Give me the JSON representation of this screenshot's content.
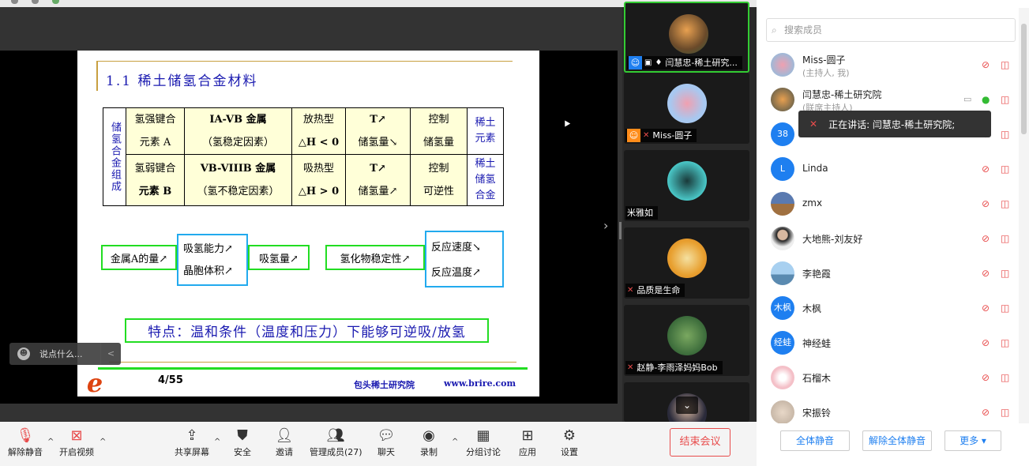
{
  "slide": {
    "title": "1.1  稀土储氢合金材料",
    "table": {
      "row_header": "储氢合金组成",
      "row1": [
        "氢强键合",
        "元素 A",
        "IA-VB 金属",
        "（氢稳定因素）",
        "放热型",
        "△H < 0",
        "T↗",
        "储氢量↘",
        "控制",
        "储氢量"
      ],
      "row2": [
        "氢弱键合",
        "元素 B",
        "VB-VIIIB 金属",
        "（氢不稳定因素）",
        "吸热型",
        "△H > 0",
        "T↗",
        "储氢量↗",
        "控制",
        "可逆性"
      ],
      "side_top": "稀土元素",
      "side_bottom": "稀土储氢合金"
    },
    "flow1": {
      "a": "金属A的量↗",
      "b1": "吸氢能力↗",
      "b2": "晶胞体积↗",
      "c": "吸氢量↗"
    },
    "flow2": {
      "a": "氢化物稳定性↗",
      "b1": "反应速度↘",
      "b2": "反应温度↗"
    },
    "feature": "特点：温和条件（温度和压力）下能够可逆吸/放氢",
    "logo": "e",
    "page": "4/55",
    "org": "包头稀土研究院",
    "url": "www.brire.com"
  },
  "chat": {
    "placeholder": "说点什么...",
    "arrow": "<"
  },
  "collapse_arrow": "›",
  "video_tiles": [
    {
      "name": "闫慧忠-稀土研究...",
      "active": true
    },
    {
      "name": "Miss-圆子",
      "active": false
    },
    {
      "name": "米雅如",
      "active": false
    },
    {
      "name": "品质是生命",
      "active": false
    },
    {
      "name": "赵静-李雨泽妈妈Bob",
      "active": false
    },
    {
      "name": "",
      "active": false
    }
  ],
  "panel": {
    "search_placeholder": "搜索成员",
    "participants": [
      {
        "name": "Miss-圆子",
        "sub": "(主持人, 我)",
        "avatar": "",
        "color": "#9fb9d8"
      },
      {
        "name": "闫慧忠-稀土研究院",
        "sub": "(联席主持人)",
        "avatar": "",
        "color": "#7a6a4c"
      },
      {
        "name": "",
        "sub": "",
        "avatar": "38",
        "color": "#1e7ff0"
      },
      {
        "name": "Linda",
        "sub": "",
        "avatar": "L",
        "color": "#1e7ff0"
      },
      {
        "name": "zmx",
        "sub": "",
        "avatar": "",
        "color": "#5a7a9a"
      },
      {
        "name": "大地熊-刘友好",
        "sub": "",
        "avatar": "",
        "color": "#d8d8d8"
      },
      {
        "name": "李艳霞",
        "sub": "",
        "avatar": "",
        "color": "#8ab8d8"
      },
      {
        "name": "木枫",
        "sub": "",
        "avatar": "木枫",
        "color": "#1e7ff0"
      },
      {
        "name": "神经蛙",
        "sub": "",
        "avatar": "经蛙",
        "color": "#1e7ff0"
      },
      {
        "name": "石榴木",
        "sub": "",
        "avatar": "",
        "color": "#f4c0c8"
      },
      {
        "name": "宋振铃",
        "sub": "",
        "avatar": "",
        "color": "#c8b8a8"
      }
    ],
    "speaking": "正在讲话: 闫慧忠-稀土研究院;",
    "mute_all": "全体静音",
    "unmute_all": "解除全体静音",
    "more": "更多 ▾"
  },
  "toolbar": {
    "unmute": "解除静音",
    "start_video": "开启视频",
    "share": "共享屏幕",
    "security": "安全",
    "invite": "邀请",
    "manage": "管理成员(27)",
    "chat": "聊天",
    "record": "录制",
    "breakout": "分组讨论",
    "apps": "应用",
    "settings": "设置",
    "end": "结束会议"
  }
}
